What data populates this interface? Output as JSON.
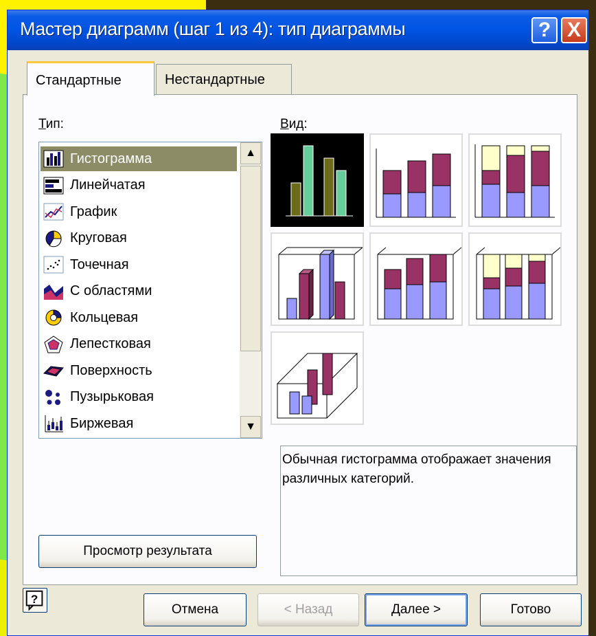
{
  "window": {
    "title": "Мастер диаграмм (шаг 1 из 4): тип диаграммы",
    "help_label": "?",
    "close_label": "X"
  },
  "tabs": [
    {
      "label": "Стандартные",
      "active": true
    },
    {
      "label": "Нестандартные",
      "active": false
    }
  ],
  "type_section": {
    "label": "Тип:",
    "items": [
      {
        "label": "Гистограмма",
        "icon": "column-chart-icon",
        "selected": true
      },
      {
        "label": "Линейчатая",
        "icon": "bar-chart-icon"
      },
      {
        "label": "График",
        "icon": "line-chart-icon"
      },
      {
        "label": "Круговая",
        "icon": "pie-chart-icon"
      },
      {
        "label": "Точечная",
        "icon": "scatter-chart-icon"
      },
      {
        "label": "С областями",
        "icon": "area-chart-icon"
      },
      {
        "label": "Кольцевая",
        "icon": "doughnut-chart-icon"
      },
      {
        "label": "Лепестковая",
        "icon": "radar-chart-icon"
      },
      {
        "label": "Поверхность",
        "icon": "surface-chart-icon"
      },
      {
        "label": "Пузырьковая",
        "icon": "bubble-chart-icon"
      },
      {
        "label": "Биржевая",
        "icon": "stock-chart-icon"
      }
    ]
  },
  "view_section": {
    "label": "Вид:",
    "selected_index": 0,
    "description": "Обычная гистограмма отображает значения различных категорий."
  },
  "preview_button": "Просмотр результата",
  "buttons": {
    "cancel": "Отмена",
    "back": "< Назад",
    "next": "Далее >",
    "finish": "Готово"
  },
  "colors": {
    "bar_dark": "#6b6b1a",
    "bar_green": "#66cc99",
    "violet": "#9999ff",
    "plum": "#993366",
    "cream": "#ffffcc"
  }
}
